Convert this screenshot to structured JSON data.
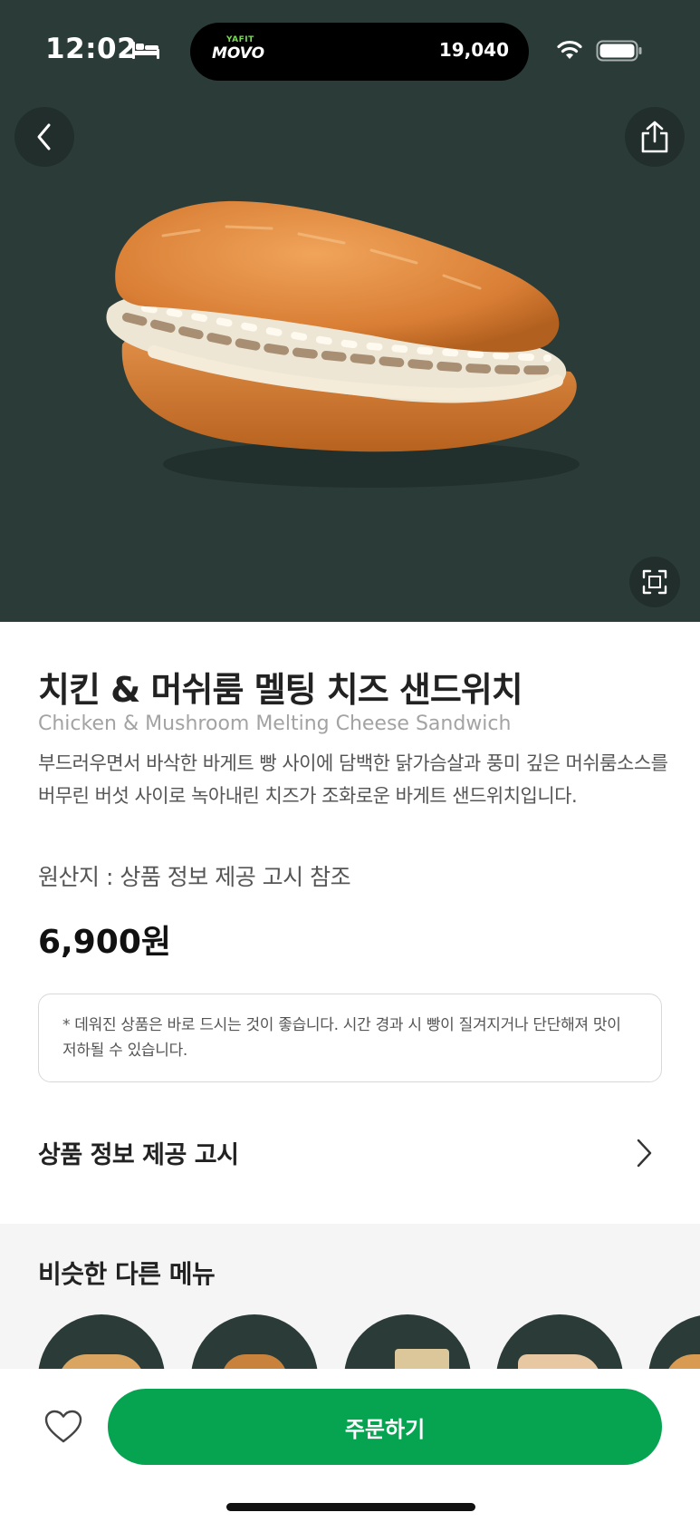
{
  "status_bar": {
    "time": "12:02",
    "island_brand_small": "YAFIT",
    "island_brand": "MOVO",
    "island_steps": "19,040"
  },
  "product": {
    "name_ko": "치킨 & 머쉬룸 멜팅 치즈 샌드위치",
    "name_en": "Chicken & Mushroom Melting Cheese Sandwich",
    "description": "부드러우면서 바삭한 바게트 빵 사이에 담백한 닭가슴살과 풍미 깊은 머쉬룸소스를 버무린 버섯 사이로 녹아내린 치즈가 조화로운 바게트 샌드위치입니다.",
    "origin": "원산지 : 상품 정보 제공 고시 참조",
    "price": "6,900원",
    "notice": "* 데워진 상품은 바로 드시는 것이 좋습니다. 시간 경과 시 빵이 질겨지거나 단단해져 맛이 저하될 수 있습니다."
  },
  "info_link": {
    "label": "상품 정보 제공 고시"
  },
  "similar_menu": {
    "title": "비슷한 다른 메뉴",
    "items": [
      {
        "icon": "food-thumbnail-1"
      },
      {
        "icon": "food-thumbnail-2"
      },
      {
        "icon": "food-thumbnail-3"
      },
      {
        "icon": "food-thumbnail-4"
      },
      {
        "icon": "food-thumbnail-5"
      }
    ]
  },
  "bottom_bar": {
    "order_label": "주문하기"
  },
  "colors": {
    "hero_bg": "#2b3c38",
    "accent_green": "#06a451",
    "similar_bg": "#f5f5f5"
  }
}
